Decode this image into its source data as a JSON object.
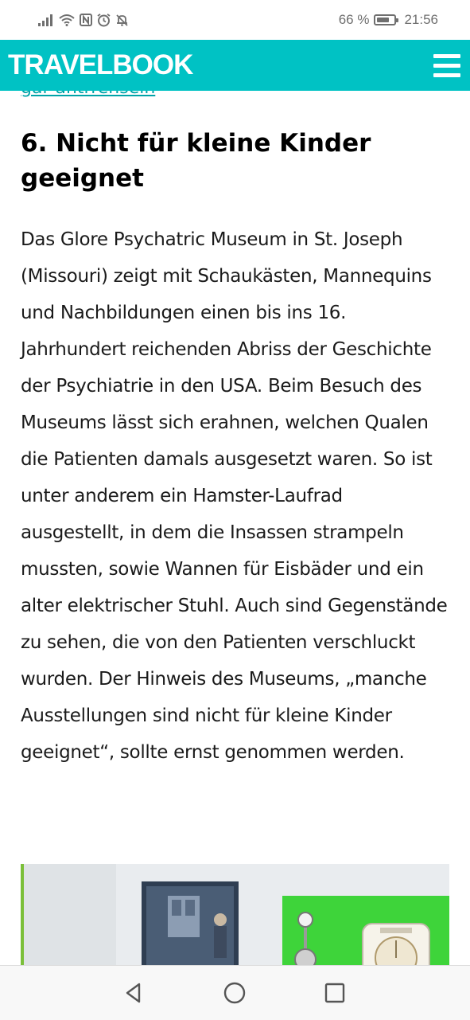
{
  "status_bar": {
    "battery_percent": "66 %",
    "battery_level": 0.66,
    "time": "21:56",
    "icons": [
      "signal-icon",
      "wifi-icon",
      "nfc-icon",
      "alarm-icon",
      "mute-icon"
    ]
  },
  "header": {
    "logo": "TRAVELBOOK",
    "menu_icon": "hamburger-menu-icon",
    "brand_color": "#00c2c4"
  },
  "clipped_link": {
    "text": "gar antrrensein"
  },
  "article": {
    "heading": "6. Nicht für kleine Kinder geeignet",
    "body": "Das Glore Psychatric Museum in St. Joseph (Missouri) zeigt mit Schaukästen, Mannequins und Nachbildungen einen bis ins 16. Jahrhundert reichenden Abriss der Geschichte der Psychiatrie in den USA. Beim Besuch des Museums lässt sich erahnen, welchen Qualen die Patienten damals ausgesetzt waren. So ist unter anderem ein Hamster-Laufrad ausgestellt, in dem die Insassen strampeln mussten, sowie Wannen für Eisbäder und ein alter elektrischer Stuhl. Auch sind Gegenstände zu sehen, die von den Patienten verschluckt wurden. Der Hinweis des Museums, „manche Ausstellungen sind nicht für kleine Kinder geeignet“, sollte ernst genommen werden."
  },
  "nav_bar": {
    "buttons": [
      "back-icon",
      "home-icon",
      "recents-icon"
    ]
  }
}
